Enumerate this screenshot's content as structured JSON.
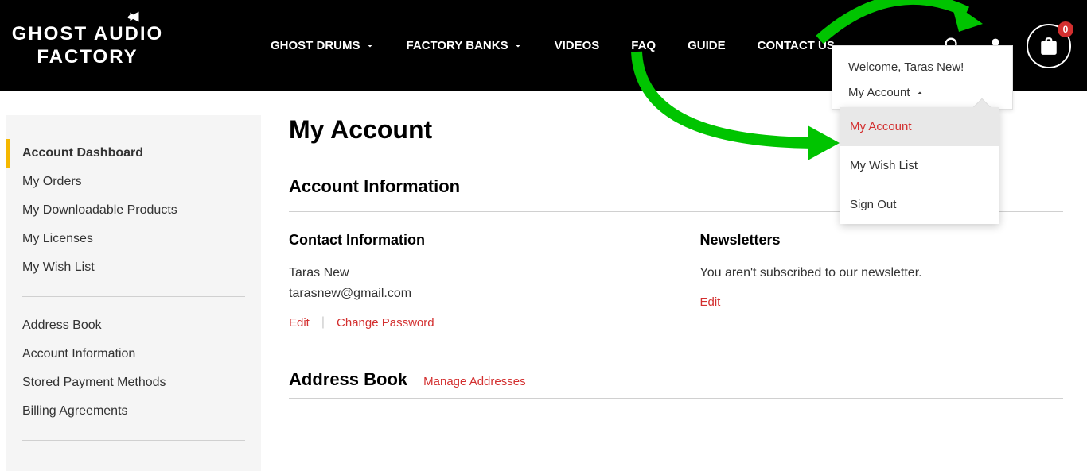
{
  "logo": {
    "line1": "GHOST AUDIO",
    "line2": "FACTORY"
  },
  "nav": {
    "ghost_drums": "GHOST DRUMS",
    "factory_banks": "FACTORY BANKS",
    "videos": "VIDEOS",
    "faq": "FAQ",
    "guide": "GUIDE",
    "contact": "CONTACT US"
  },
  "cart": {
    "count": "0"
  },
  "welcome": {
    "greeting": "Welcome, Taras New!",
    "account_toggle": "My Account"
  },
  "dropdown": {
    "my_account": "My Account",
    "wishlist": "My Wish List",
    "signout": "Sign Out"
  },
  "sidebar": {
    "dashboard": "Account Dashboard",
    "orders": "My Orders",
    "downloadable": "My Downloadable Products",
    "licenses": "My Licenses",
    "wishlist": "My Wish List",
    "address_book": "Address Book",
    "account_info": "Account Information",
    "payment": "Stored Payment Methods",
    "billing": "Billing Agreements"
  },
  "main": {
    "title": "My Account",
    "account_info_title": "Account Information",
    "contact": {
      "title": "Contact Information",
      "name": "Taras New",
      "email": "tarasnew@gmail.com",
      "edit": "Edit",
      "change_password": "Change Password"
    },
    "newsletters": {
      "title": "Newsletters",
      "status": "You aren't subscribed to our newsletter.",
      "edit": "Edit"
    },
    "address_book": {
      "title": "Address Book",
      "manage": "Manage Addresses"
    }
  }
}
